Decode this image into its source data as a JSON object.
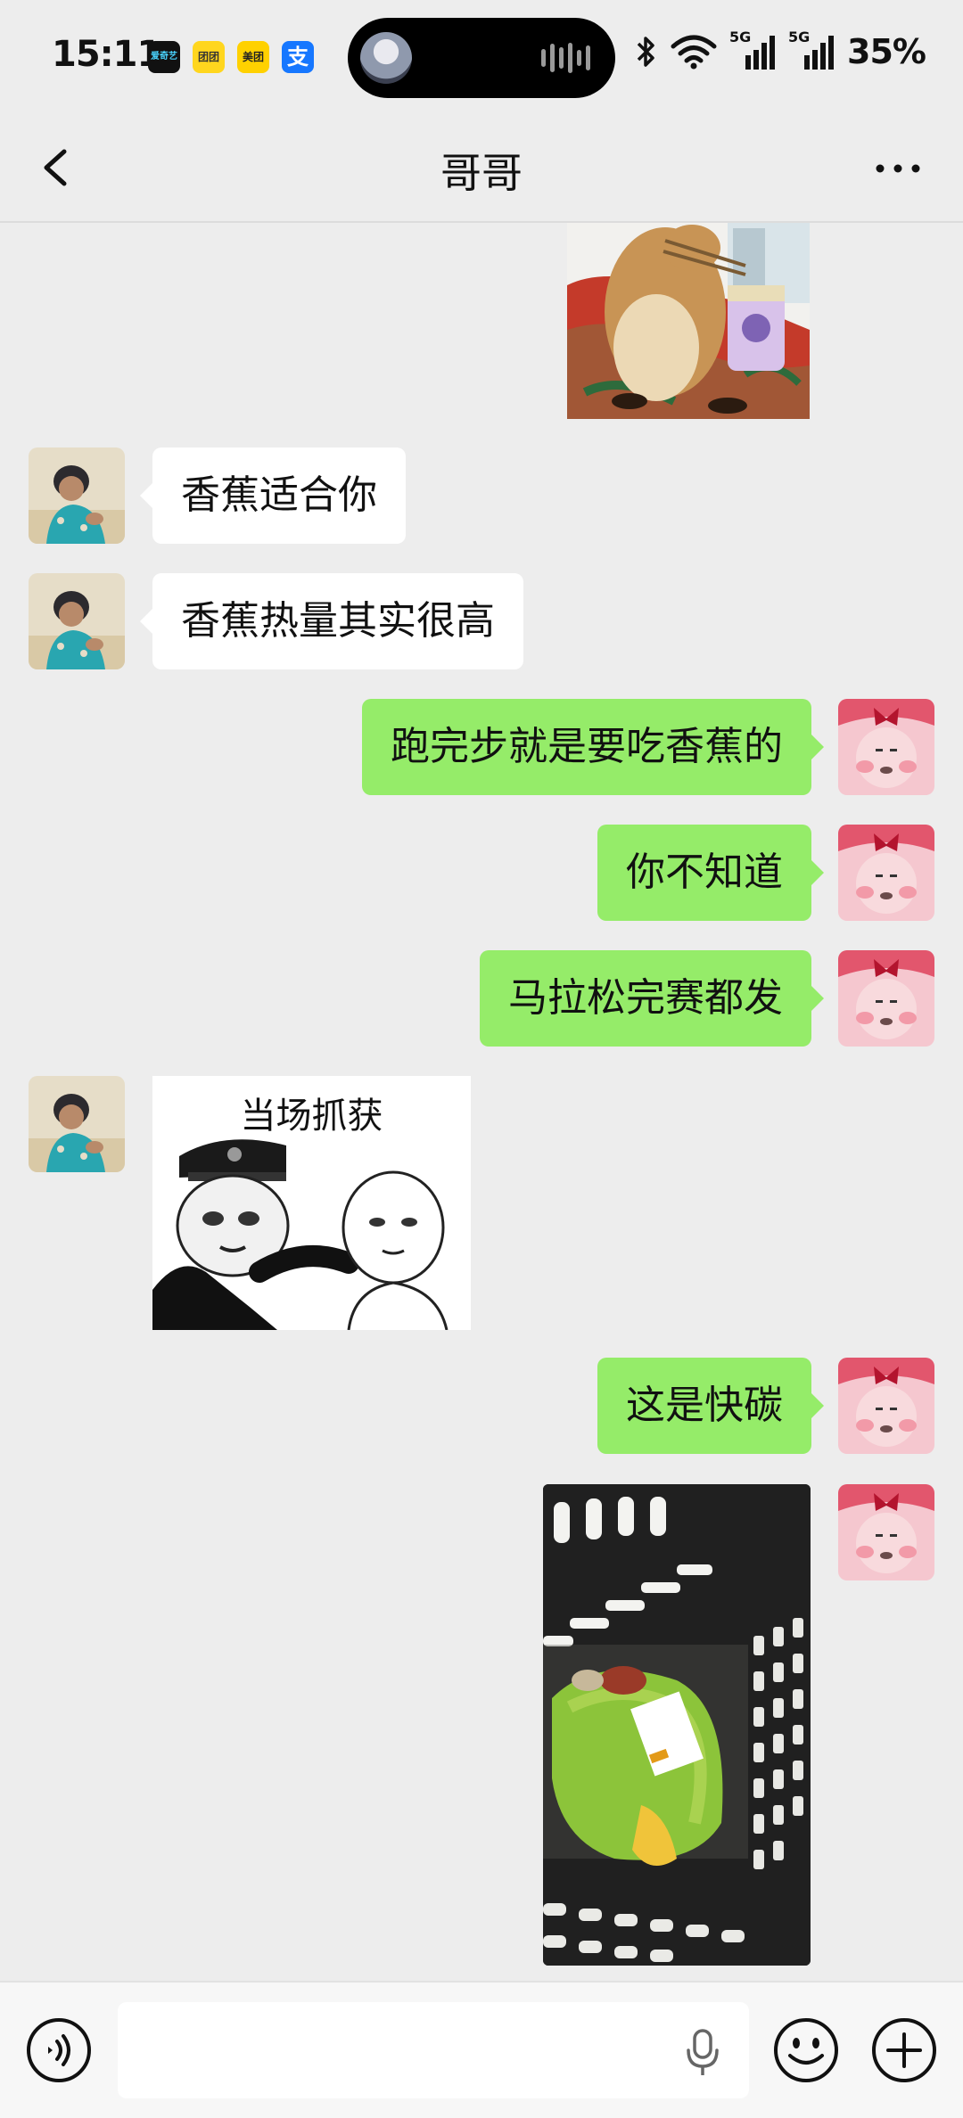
{
  "status_bar": {
    "time": "15:11",
    "apps": [
      {
        "icon": "iqiyi-app-icon",
        "label": "爱奇艺",
        "bg": "#111111",
        "fg": "#4ad4ff"
      },
      {
        "icon": "tuantuan-app-icon",
        "label": "团团",
        "bg": "#ffd61e",
        "fg": "#333333"
      },
      {
        "icon": "meituan-app-icon",
        "label": "美团",
        "bg": "#ffd100",
        "fg": "#222222"
      },
      {
        "icon": "alipay-app-icon",
        "label": "支",
        "bg": "#1677ff",
        "fg": "#ffffff"
      }
    ],
    "network_1": "5G",
    "network_2": "5G",
    "battery": "35%"
  },
  "nav": {
    "title": "哥哥"
  },
  "messages": [
    {
      "type": "image",
      "side": "right",
      "image": "cat-eating-noodles-sticker"
    },
    {
      "type": "text",
      "side": "left",
      "text": "香蕉适合你"
    },
    {
      "type": "text",
      "side": "left",
      "text": "香蕉热量其实很高"
    },
    {
      "type": "text",
      "side": "right",
      "text": "跑完步就是要吃香蕉的"
    },
    {
      "type": "text",
      "side": "right",
      "text": "你不知道"
    },
    {
      "type": "text",
      "side": "right",
      "text": "马拉松完赛都发"
    },
    {
      "type": "image",
      "side": "left",
      "image": "panda-meme-sticker",
      "caption": "当场抓获"
    },
    {
      "type": "text",
      "side": "right",
      "text": "这是快碳"
    },
    {
      "type": "image",
      "side": "right",
      "image": "basket-photo"
    }
  ],
  "colors": {
    "background": "#ededed",
    "bubble_out": "#95ec69",
    "bubble_in": "#ffffff"
  },
  "input": {
    "placeholder": ""
  }
}
